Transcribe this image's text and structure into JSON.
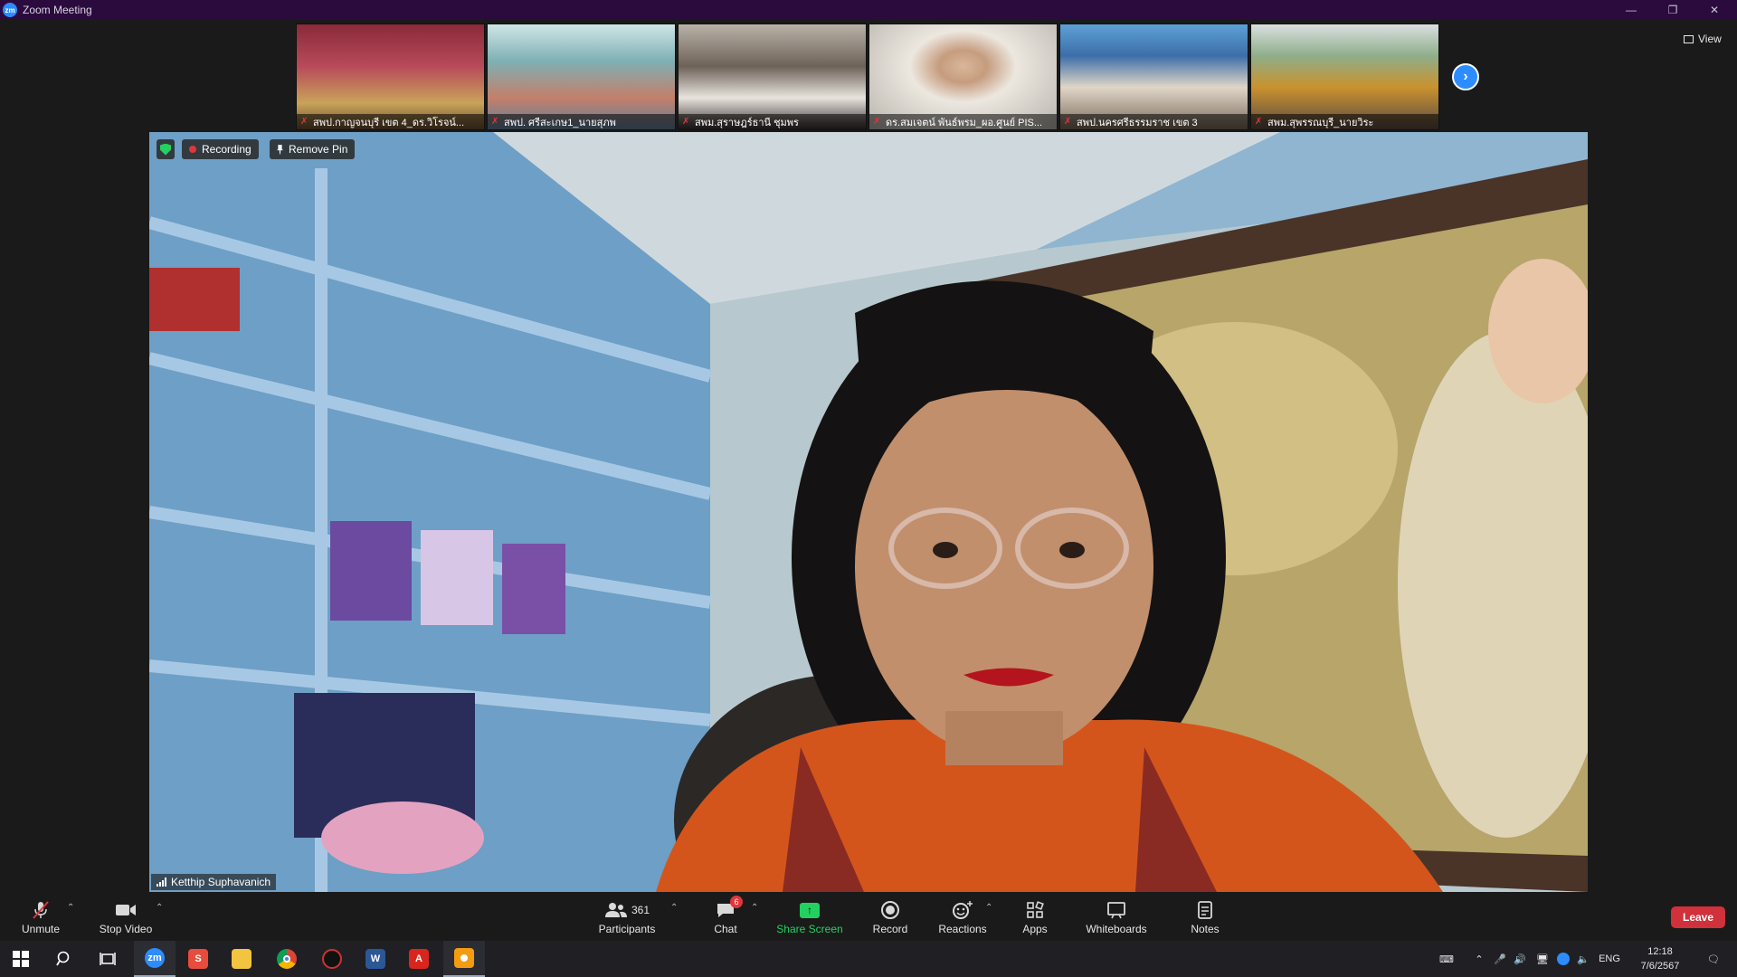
{
  "window": {
    "title": "Zoom Meeting",
    "app_icon": "zm",
    "controls": [
      "minimize-icon",
      "restore-icon",
      "close-icon"
    ]
  },
  "gallery": {
    "participants": [
      {
        "name": "สพป.กาญจนบุรี เขต 4_ดร.วิโรจน์...",
        "muted": true
      },
      {
        "name": "สพป. ศรีสะเกษ1_นายสุภพ",
        "muted": true
      },
      {
        "name": "สพม.สุราษฎร์ธานี ชุมพร",
        "muted": true
      },
      {
        "name": "ดร.สมเจตน์ พันธ์พรม_ผอ.ศูนย์ PIS...",
        "muted": true
      },
      {
        "name": "สพป.นครศรีธรรมราช เขต 3",
        "muted": true
      },
      {
        "name": "สพม.สุพรรณบุรี_นายวิระ",
        "muted": true
      }
    ],
    "next_icon": "chevron-right-icon",
    "view_label": "View"
  },
  "main_video": {
    "recording_label": "Recording",
    "remove_pin_label": "Remove Pin",
    "speaker_name": "Ketthip Suphavanich"
  },
  "toolbar": {
    "unmute_label": "Unmute",
    "stop_video_label": "Stop Video",
    "participants_label": "Participants",
    "participants_count": "361",
    "chat_label": "Chat",
    "chat_badge": "6",
    "share_label": "Share Screen",
    "record_label": "Record",
    "reactions_label": "Reactions",
    "apps_label": "Apps",
    "whiteboards_label": "Whiteboards",
    "notes_label": "Notes",
    "leave_label": "Leave"
  },
  "taskbar": {
    "apps": [
      "windows-start",
      "search",
      "task-view",
      "zoom",
      "wps",
      "file-explorer",
      "chrome",
      "app",
      "word",
      "acrobat",
      "app-active"
    ],
    "language": "ENG",
    "time": "12:18",
    "date": "7/6/2567",
    "colors": {
      "zoom": "#2d8cff",
      "wps": "#e74c3c",
      "explorer": "#f3c440",
      "word": "#2b5797",
      "acrobat": "#d8261e",
      "active_app": "#f39c12"
    }
  }
}
